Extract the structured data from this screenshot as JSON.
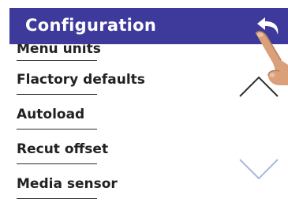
{
  "header": {
    "title": "Configuration",
    "back_icon": "back-arrow-icon"
  },
  "menu": {
    "items": [
      {
        "label": "Menu units"
      },
      {
        "label": "Flactory defaults"
      },
      {
        "label": "Autoload"
      },
      {
        "label": "Recut offset"
      },
      {
        "label": "Media sensor"
      }
    ]
  },
  "scroll": {
    "up_icon": "chevron-up-icon",
    "down_icon": "chevron-down-icon"
  },
  "colors": {
    "header_bg": "#3d3a9c",
    "text": "#222222",
    "chevron_up": "#2f2f2f",
    "chevron_down": "#a9b9d8"
  }
}
